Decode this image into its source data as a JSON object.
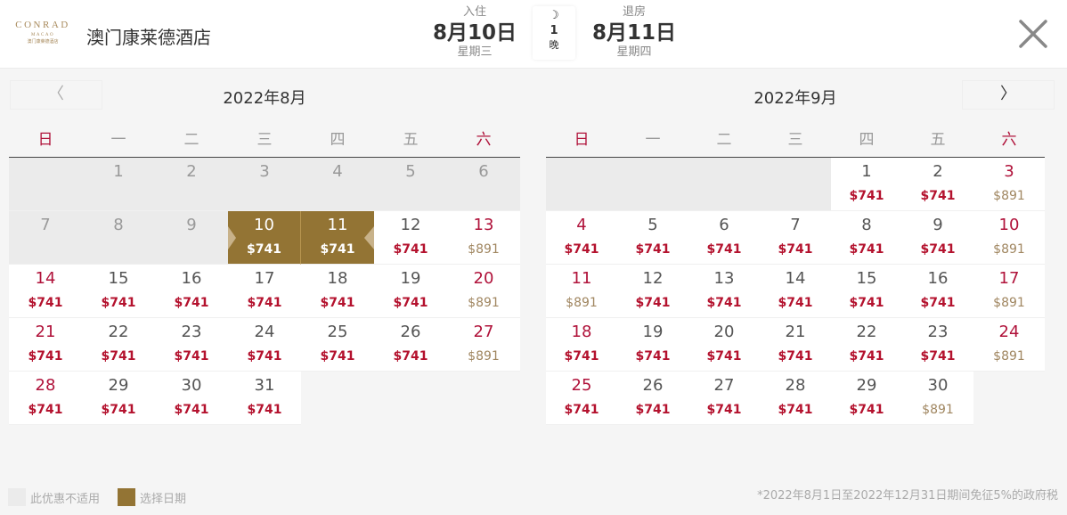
{
  "header": {
    "logo": {
      "line1": "CONRAD",
      "line2": "MACAO",
      "line3": "澳门康莱德酒店"
    },
    "hotel_name": "澳门康莱德酒店",
    "checkin": {
      "label": "入住",
      "date": "8月10日",
      "weekday": "星期三"
    },
    "nights": {
      "icon": "moon-icon",
      "count": "1",
      "unit": "晚"
    },
    "checkout": {
      "label": "退房",
      "date": "8月11日",
      "weekday": "星期四"
    },
    "close_icon": "close-icon"
  },
  "nav": {
    "prev": "〈",
    "next": "〉"
  },
  "weekdays": [
    "日",
    "一",
    "二",
    "三",
    "四",
    "五",
    "六"
  ],
  "months": [
    {
      "title": "2022年8月",
      "leading_blank": 1,
      "days": [
        {
          "d": "1",
          "p": "",
          "s": "na"
        },
        {
          "d": "2",
          "p": "",
          "s": "na"
        },
        {
          "d": "3",
          "p": "",
          "s": "na"
        },
        {
          "d": "4",
          "p": "",
          "s": "na"
        },
        {
          "d": "5",
          "p": "",
          "s": "na"
        },
        {
          "d": "6",
          "p": "",
          "s": "na"
        },
        {
          "d": "7",
          "p": "",
          "s": "na"
        },
        {
          "d": "8",
          "p": "",
          "s": "na"
        },
        {
          "d": "9",
          "p": "",
          "s": "na"
        },
        {
          "d": "10",
          "p": "$741",
          "s": "sel start"
        },
        {
          "d": "11",
          "p": "$741",
          "s": "sel end"
        },
        {
          "d": "12",
          "p": "$741",
          "s": "avail"
        },
        {
          "d": "13",
          "p": "$891",
          "s": "avail"
        },
        {
          "d": "14",
          "p": "$741",
          "s": "avail"
        },
        {
          "d": "15",
          "p": "$741",
          "s": "avail"
        },
        {
          "d": "16",
          "p": "$741",
          "s": "avail"
        },
        {
          "d": "17",
          "p": "$741",
          "s": "avail"
        },
        {
          "d": "18",
          "p": "$741",
          "s": "avail"
        },
        {
          "d": "19",
          "p": "$741",
          "s": "avail"
        },
        {
          "d": "20",
          "p": "$891",
          "s": "avail"
        },
        {
          "d": "21",
          "p": "$741",
          "s": "avail"
        },
        {
          "d": "22",
          "p": "$741",
          "s": "avail"
        },
        {
          "d": "23",
          "p": "$741",
          "s": "avail"
        },
        {
          "d": "24",
          "p": "$741",
          "s": "avail"
        },
        {
          "d": "25",
          "p": "$741",
          "s": "avail"
        },
        {
          "d": "26",
          "p": "$741",
          "s": "avail"
        },
        {
          "d": "27",
          "p": "$891",
          "s": "avail"
        },
        {
          "d": "28",
          "p": "$741",
          "s": "avail"
        },
        {
          "d": "29",
          "p": "$741",
          "s": "avail"
        },
        {
          "d": "30",
          "p": "$741",
          "s": "avail"
        },
        {
          "d": "31",
          "p": "$741",
          "s": "avail"
        }
      ]
    },
    {
      "title": "2022年9月",
      "leading_blank": 4,
      "days": [
        {
          "d": "1",
          "p": "$741",
          "s": "avail"
        },
        {
          "d": "2",
          "p": "$741",
          "s": "avail"
        },
        {
          "d": "3",
          "p": "$891",
          "s": "avail"
        },
        {
          "d": "4",
          "p": "$741",
          "s": "avail"
        },
        {
          "d": "5",
          "p": "$741",
          "s": "avail"
        },
        {
          "d": "6",
          "p": "$741",
          "s": "avail"
        },
        {
          "d": "7",
          "p": "$741",
          "s": "avail"
        },
        {
          "d": "8",
          "p": "$741",
          "s": "avail"
        },
        {
          "d": "9",
          "p": "$741",
          "s": "avail"
        },
        {
          "d": "10",
          "p": "$891",
          "s": "avail"
        },
        {
          "d": "11",
          "p": "$891",
          "s": "avail"
        },
        {
          "d": "12",
          "p": "$741",
          "s": "avail"
        },
        {
          "d": "13",
          "p": "$741",
          "s": "avail"
        },
        {
          "d": "14",
          "p": "$741",
          "s": "avail"
        },
        {
          "d": "15",
          "p": "$741",
          "s": "avail"
        },
        {
          "d": "16",
          "p": "$741",
          "s": "avail"
        },
        {
          "d": "17",
          "p": "$891",
          "s": "avail"
        },
        {
          "d": "18",
          "p": "$741",
          "s": "avail"
        },
        {
          "d": "19",
          "p": "$741",
          "s": "avail"
        },
        {
          "d": "20",
          "p": "$741",
          "s": "avail"
        },
        {
          "d": "21",
          "p": "$741",
          "s": "avail"
        },
        {
          "d": "22",
          "p": "$741",
          "s": "avail"
        },
        {
          "d": "23",
          "p": "$741",
          "s": "avail"
        },
        {
          "d": "24",
          "p": "$891",
          "s": "avail"
        },
        {
          "d": "25",
          "p": "$741",
          "s": "avail"
        },
        {
          "d": "26",
          "p": "$741",
          "s": "avail"
        },
        {
          "d": "27",
          "p": "$741",
          "s": "avail"
        },
        {
          "d": "28",
          "p": "$741",
          "s": "avail"
        },
        {
          "d": "29",
          "p": "$741",
          "s": "avail"
        },
        {
          "d": "30",
          "p": "$891",
          "s": "avail"
        }
      ]
    }
  ],
  "price_high": "$891",
  "legend": {
    "not_applicable": "此优惠不适用",
    "selected": "选择日期"
  },
  "footnote": "*2022年8月1日至2022年12月31日期间免征5%的政府税",
  "colors": {
    "accent_gold": "#937434",
    "price_red": "#b4122e",
    "weekend_red": "#b0123a",
    "high_price": "#a08660",
    "unavailable_bg": "#ebebeb"
  }
}
